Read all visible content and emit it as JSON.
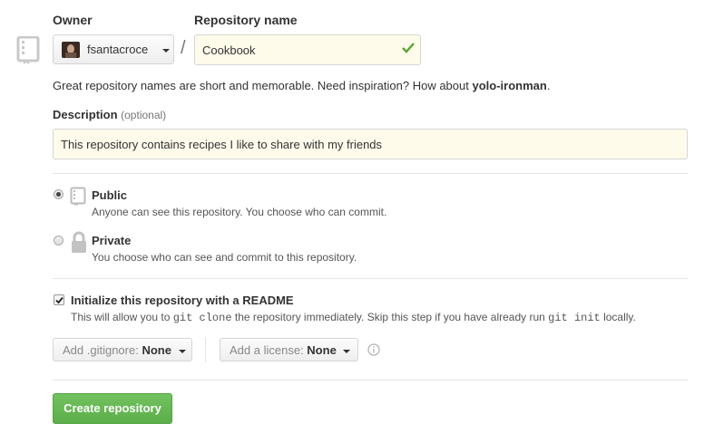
{
  "owner": {
    "label": "Owner",
    "value": "fsantacroce",
    "separator": "/"
  },
  "repo_name": {
    "label": "Repository name",
    "value": "Cookbook"
  },
  "name_hint": {
    "text": "Great repository names are short and memorable. Need inspiration? How about ",
    "suggestion": "yolo-ironman",
    "end": "."
  },
  "description": {
    "label": "Description",
    "optional": "(optional)",
    "value": "This repository contains recipes I like to share with my friends"
  },
  "visibility": {
    "selected": "public",
    "public": {
      "title": "Public",
      "desc": "Anyone can see this repository. You choose who can commit."
    },
    "private": {
      "title": "Private",
      "desc": "You choose who can see and commit to this repository."
    }
  },
  "readme": {
    "checked": true,
    "title": "Initialize this repository with a README",
    "desc_1": "This will allow you to ",
    "code_1": "git clone",
    "desc_2": " the repository immediately. Skip this step if you have already run ",
    "code_2": "git init",
    "desc_3": " locally."
  },
  "gitignore": {
    "prefix": "Add .gitignore:",
    "value": "None"
  },
  "license": {
    "prefix": "Add a license:",
    "value": "None"
  },
  "icons": {
    "repo": "repo-book-icon",
    "check": "check-icon",
    "lock": "lock-icon",
    "info": "info-icon",
    "avatar": "avatar"
  },
  "colors": {
    "primary_button": "#6cc644",
    "check": "#55a532",
    "field_bg": "#fffbeb"
  },
  "submit_label": "Create repository"
}
